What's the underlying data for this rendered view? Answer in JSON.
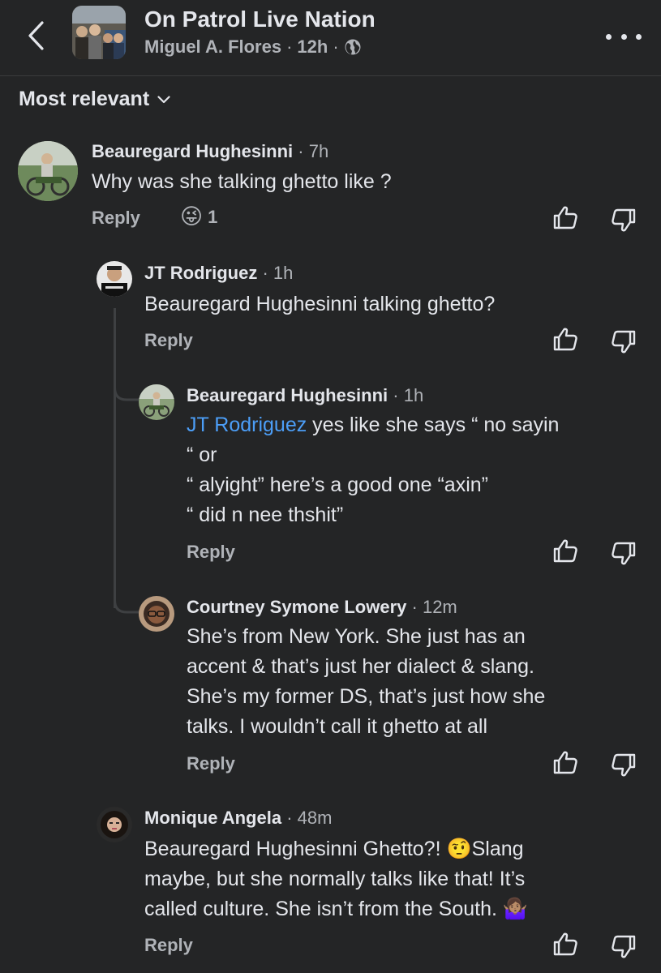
{
  "header": {
    "group_name": "On Patrol Live Nation",
    "author": "Miguel A. Flores",
    "time": "12h",
    "separator": "·"
  },
  "sort": {
    "label": "Most relevant"
  },
  "comments": [
    {
      "author": "Beauregard Hughesinni",
      "time": "· 7h",
      "text": "Why was she talking ghetto like ?",
      "reply_label": "Reply",
      "reaction_count": "1",
      "reaction_emoji": "😜"
    },
    {
      "author": "JT Rodriguez",
      "time": "· 1h",
      "text": "Beauregard Hughesinni talking ghetto?",
      "reply_label": "Reply"
    },
    {
      "author": "Beauregard Hughesinni",
      "time": "· 1h",
      "mention": "JT Rodriguez",
      "lines": [
        " yes like she says “ no sayin",
        "“ or",
        "“ alyight” here’s a good one “axin”",
        "“ did n nee thshit”"
      ],
      "reply_label": "Reply"
    },
    {
      "author": "Courtney Symone Lowery",
      "time": "· 12m",
      "lines": [
        "She’s from New York. She just has an",
        "accent & that’s just her dialect & slang.",
        "She’s my former DS, that’s just how she",
        "talks. I wouldn’t call it ghetto at all"
      ],
      "reply_label": "Reply"
    },
    {
      "author": "Monique Angela",
      "time": "· 48m",
      "line1_a": "Beauregard Hughesinni Ghetto?! ",
      "emoji_1": "🤨",
      "line1_b": "Slang",
      "line2": "maybe, but she normally talks like that! It’s",
      "line3": "called culture. She isn’t from the South. ",
      "emoji_2": "🤷🏽‍♀️",
      "reply_label": "Reply"
    }
  ],
  "icons": {
    "back": "chevron-left-icon",
    "more": "more-horizontal-icon",
    "globe": "globe-icon",
    "sort_chevron": "chevron-down-icon",
    "like": "thumbs-up-icon",
    "dislike": "thumbs-down-icon"
  },
  "colors": {
    "background": "#242526",
    "text": "#e4e6eb",
    "secondary_text": "#b0b3b8",
    "mention": "#4c9ef7",
    "divider": "#3a3b3c"
  }
}
